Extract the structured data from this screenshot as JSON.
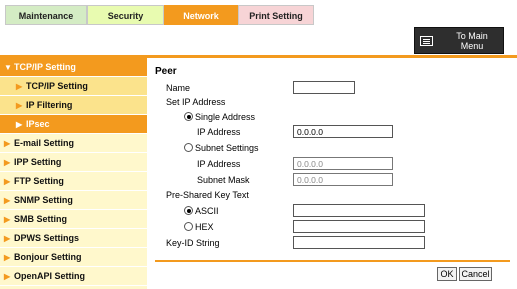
{
  "tabs": {
    "maintenance": "Maintenance",
    "security": "Security",
    "network": "Network",
    "print_setting": "Print Setting"
  },
  "main_menu": {
    "label_line1": "To Main",
    "label_line2": "Menu"
  },
  "sidebar": {
    "items": [
      {
        "label": "TCP/IP Setting"
      },
      {
        "label": "TCP/IP Setting"
      },
      {
        "label": "IP Filtering"
      },
      {
        "label": "IPsec"
      },
      {
        "label": "E-mail Setting"
      },
      {
        "label": "IPP Setting"
      },
      {
        "label": "FTP Setting"
      },
      {
        "label": "SNMP Setting"
      },
      {
        "label": "SMB Setting"
      },
      {
        "label": "DPWS Settings"
      },
      {
        "label": "Bonjour Setting"
      },
      {
        "label": "OpenAPI Setting"
      }
    ]
  },
  "form": {
    "title": "Peer",
    "name_label": "Name",
    "name_value": "",
    "set_ip_label": "Set IP Address",
    "single_address_label": "Single Address",
    "single_ip_label": "IP Address",
    "single_ip_value": "0.0.0.0",
    "subnet_settings_label": "Subnet Settings",
    "subnet_ip_label": "IP Address",
    "subnet_ip_value": "0.0.0.0",
    "subnet_mask_label": "Subnet Mask",
    "subnet_mask_value": "0.0.0.0",
    "psk_label": "Pre-Shared Key Text",
    "ascii_label": "ASCII",
    "ascii_value": "",
    "hex_label": "HEX",
    "hex_value": "",
    "keyid_label": "Key-ID String",
    "keyid_value": ""
  },
  "buttons": {
    "ok": "OK",
    "cancel": "Cancel"
  },
  "colors": {
    "accent": "#f39a1e",
    "sidebar_bg": "#fff8cc",
    "sidebar_sub_bg": "#fbe38c"
  }
}
